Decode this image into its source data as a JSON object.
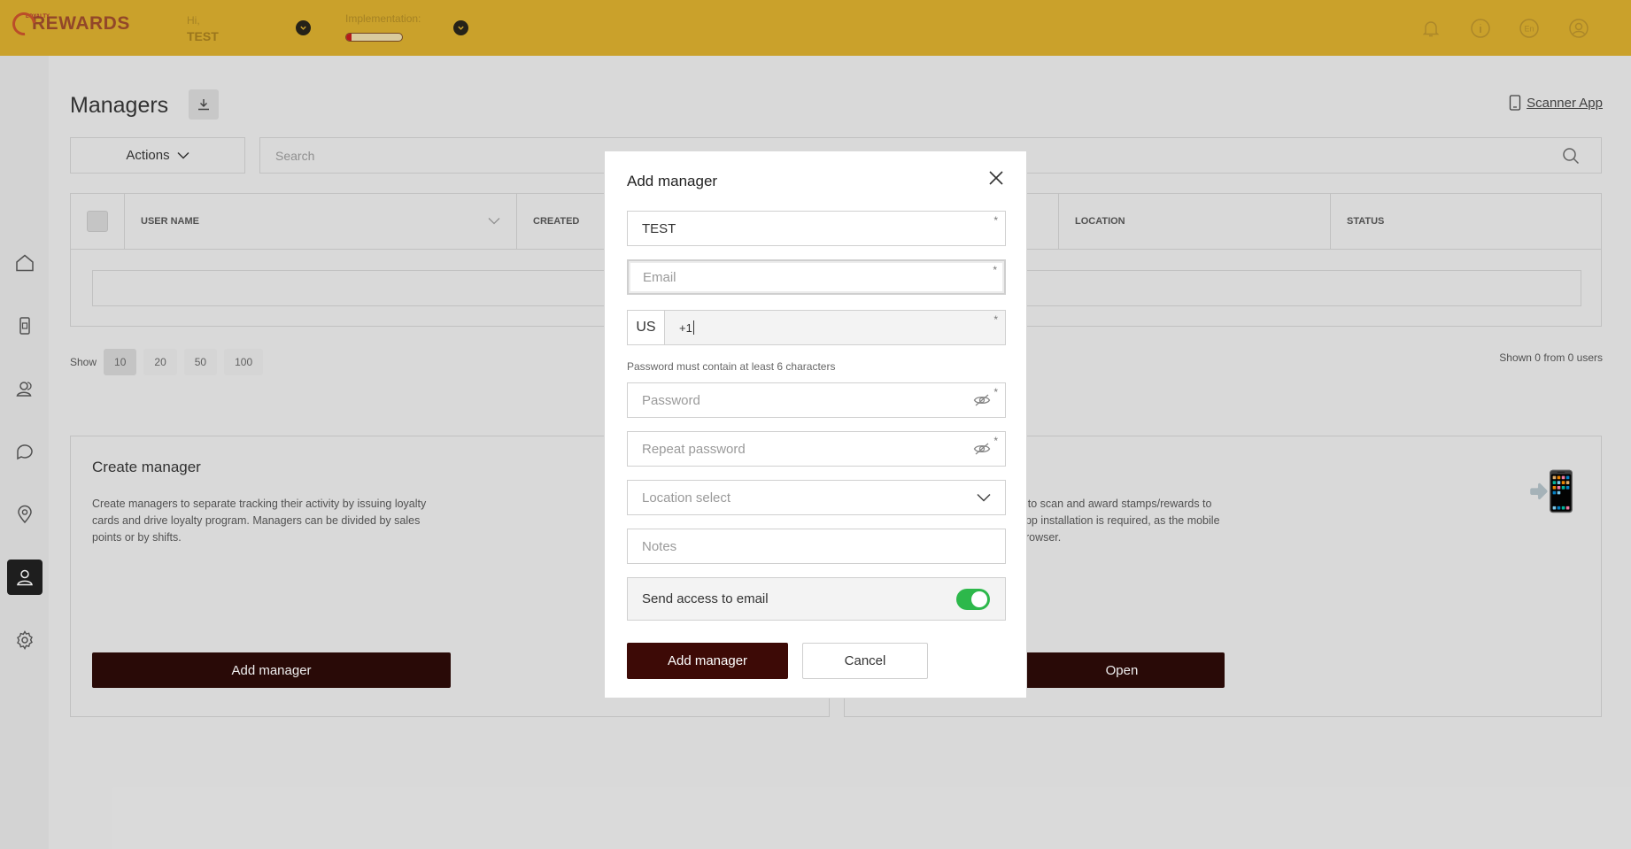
{
  "header": {
    "logo_small": "LOYALTY",
    "logo_text": "REWARDS",
    "greeting": "Hi,",
    "user_name": "TEST",
    "implementation_label": "Implementation:",
    "implementation_progress": 0.1,
    "icons": [
      "bell-icon",
      "info-icon",
      "language-icon",
      "profile-icon"
    ],
    "language": "En",
    "accent_color": "#d8ac2c"
  },
  "sidebar": {
    "items": [
      {
        "name": "home-icon"
      },
      {
        "name": "cards-icon"
      },
      {
        "name": "clients-icon"
      },
      {
        "name": "chat-icon"
      },
      {
        "name": "location-icon"
      },
      {
        "name": "managers-icon",
        "active": true
      },
      {
        "name": "settings-icon"
      }
    ]
  },
  "page": {
    "title": "Managers",
    "scanner_link": "Scanner App",
    "actions_label": "Actions",
    "search_placeholder": "Search"
  },
  "table": {
    "columns": [
      "USER NAME",
      "CREATED",
      "",
      "LOCATION",
      "STATUS"
    ]
  },
  "pagination": {
    "show_label": "Show",
    "sizes": [
      "10",
      "20",
      "50",
      "100"
    ],
    "selected": "10",
    "summary": "Shown 0 from 0 users"
  },
  "cards": {
    "create": {
      "title": "Create manager",
      "text": "Create managers to separate tracking their activity by issuing loyalty cards and drive loyalty program. Managers can be divided by sales points or by shifts.",
      "button": "Add manager"
    },
    "scanner": {
      "text": "s to scan and award stamps/rewards to app installation is required, as the mobile browser.",
      "button": "Open"
    }
  },
  "modal": {
    "title": "Add manager",
    "name_value": "TEST",
    "email_placeholder": "Email",
    "country_code": "US",
    "phone_value": "+1",
    "password_hint": "Password must contain at least 6 characters",
    "password_placeholder": "Password",
    "repeat_password_placeholder": "Repeat password",
    "location_placeholder": "Location select",
    "notes_placeholder": "Notes",
    "send_access_label": "Send access to email",
    "send_access_on": true,
    "submit_label": "Add manager",
    "cancel_label": "Cancel",
    "required_mark": "*"
  }
}
